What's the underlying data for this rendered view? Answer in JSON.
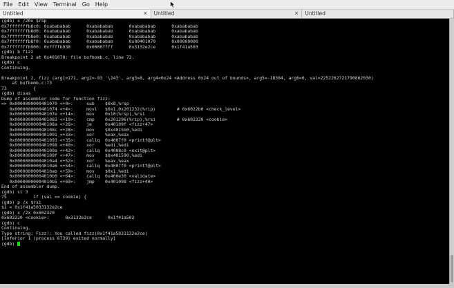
{
  "menu": [
    "File",
    "Edit",
    "View",
    "Terminal",
    "Go",
    "Help"
  ],
  "tabs": [
    {
      "label": "Untitled",
      "close": "✕",
      "active": true
    },
    {
      "label": "Untitled",
      "close": "✕",
      "active": false
    },
    {
      "label": "Untitled",
      "close": "",
      "active": false
    }
  ],
  "terminal_lines": [
    "(gdb) x /20x $rsp",
    "0x7fffffffb8c0: 0xabababab      0xabababab      0xabababab      0xabababab",
    "0x7fffffffb8d0: 0xabababab      0xabababab      0xabababab      0xabababab",
    "0x7fffffffb8e0: 0xabababab      0xabababab      0xabababab      0xabababab",
    "0x7fffffffb8f0: 0xabababab      0xabababab      0x00401070      0x00000000",
    "0x7fffffffb900: 0xffffb938      0x00007fff      0x3132e2ce      0x1f41a503",
    "(gdb) b fizz",
    "Breakpoint 2 at 0x401070: file bufbomb.c, line 73.",
    "(gdb) c",
    "Continuing.",
    "",
    "Breakpoint 2, fizz (arg1=171, arg2=-93 '\\243', arg3=8, arg4=0x24 <Address 0x24 out of bounds>, arg5=-18304, arg6=0, val=2252262721790862030)",
    "    at bufbomb.c:73",
    "73          {",
    "(gdb) disas",
    "Dump of assembler code for function fizz:",
    "=> 0x0000000000401070 <+0>:     sub    $0x8,%rsp",
    "   0x0000000000401074 <+4>:     movl   $0x1,0x201232(%rip)        # 0x6022b0 <check_level>",
    "   0x000000000040107e <+14>:    mov    0x10(%rsp),%rsi",
    "   0x0000000000401083 <+19>:    cmp    0x201296(%rip),%rsi        # 0x602320 <cookie>",
    "   0x000000000040108a <+26>:    je     0x40109f <fizz+47>",
    "   0x000000000040108c <+28>:    mov    $0x4015b0,%edi",
    "   0x0000000000401091 <+33>:    xor    %eax,%eax",
    "   0x0000000000401093 <+35>:    callq  0x4007f0 <printf@plt>",
    "   0x0000000000401098 <+40>:    xor    %edi,%edi",
    "   0x000000000040109a <+42>:    callq  0x4008c0 <exit@plt>",
    "   0x000000000040109f <+47>:    mov    $0x401590,%edi",
    "   0x00000000004010a4 <+52>:    xor    %eax,%eax",
    "   0x00000000004010a6 <+54>:    callq  0x4007f0 <printf@plt>",
    "   0x00000000004010ab <+59>:    mov    $0x1,%edi",
    "   0x00000000004010b0 <+64>:    callq  0x400e30 <validate>",
    "   0x00000000004010b5 <+69>:    jmp    0x401098 <fizz+40>",
    "End of assembler dump.",
    "(gdb) si 3",
    "75          if (val == cookie) {",
    "(gdb) p /x $rsi",
    "$1 = 0x1f41a5033132e2ce",
    "(gdb) x /2x 0x602320",
    "0x602320 <cookie>:      0x3132e2ce      0x1f41a503",
    "(gdb) c",
    "Continuing.",
    "Type string: Fizz!: You called fizz(0x1f41a5033132e2ce)",
    "[Inferior 1 (process 6739) exited normally]"
  ],
  "prompt": "(gdb) "
}
